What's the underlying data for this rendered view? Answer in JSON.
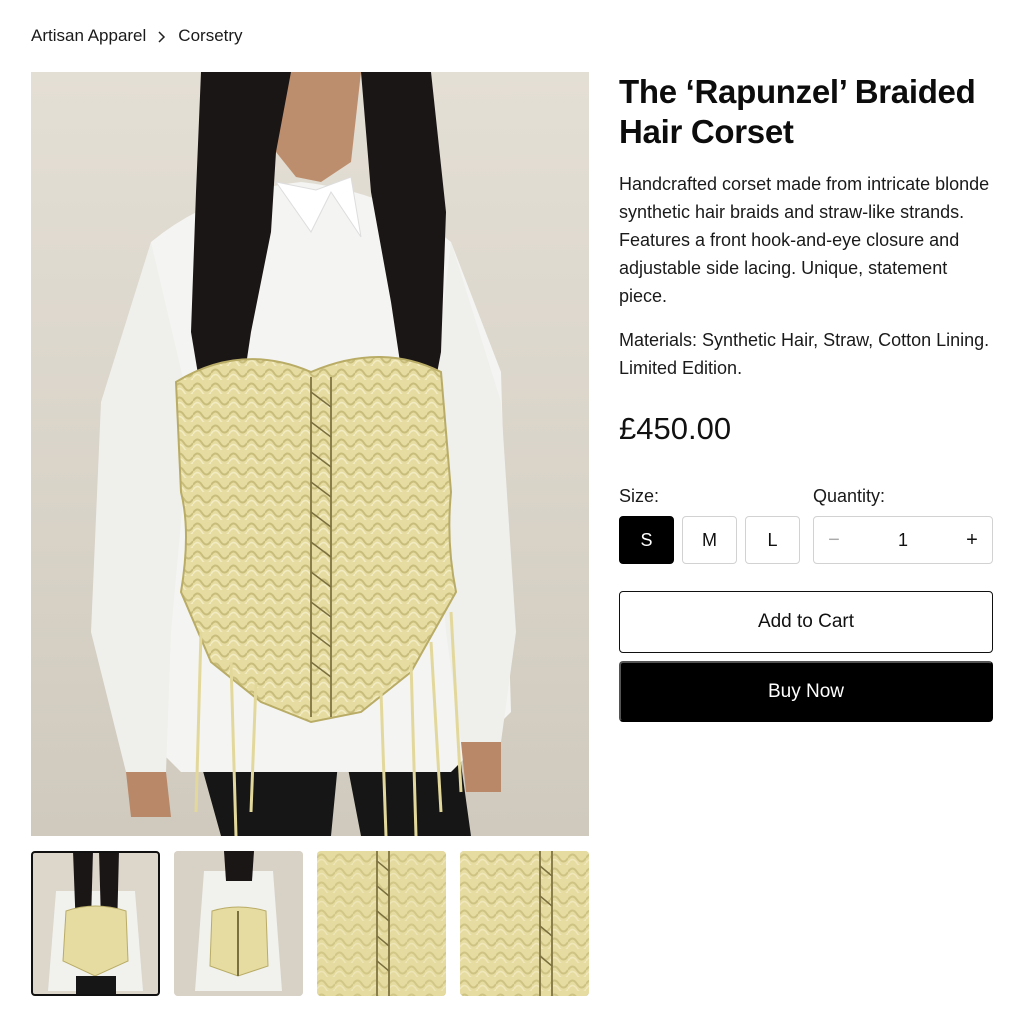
{
  "breadcrumb": {
    "items": [
      "Artisan Apparel",
      "Corsetry"
    ]
  },
  "product": {
    "title": "The ‘Rapunzel’ Braided Hair Corset",
    "description": "Handcrafted corset made from intricate blonde synthetic hair braids and straw-like strands. Features a front hook-and-eye closure and adjustable side lacing. Unique, statement piece.",
    "materials": "Materials: Synthetic Hair, Straw, Cotton Lining. Limited Edition.",
    "price": "£450.00"
  },
  "options": {
    "size_label": "Size:",
    "sizes": [
      "S",
      "M",
      "L"
    ],
    "selected_size": "S",
    "quantity_label": "Quantity:",
    "quantity": "1",
    "minus_symbol": "−",
    "plus_symbol": "+"
  },
  "actions": {
    "add_to_cart": "Add to Cart",
    "buy_now": "Buy Now"
  },
  "gallery": {
    "thumbnail_count": 4,
    "active_index": 0
  },
  "colors": {
    "primary": "#000000",
    "background": "#ffffff",
    "border": "#d2d2d2",
    "corset_blonde": "#e8dfa8"
  }
}
